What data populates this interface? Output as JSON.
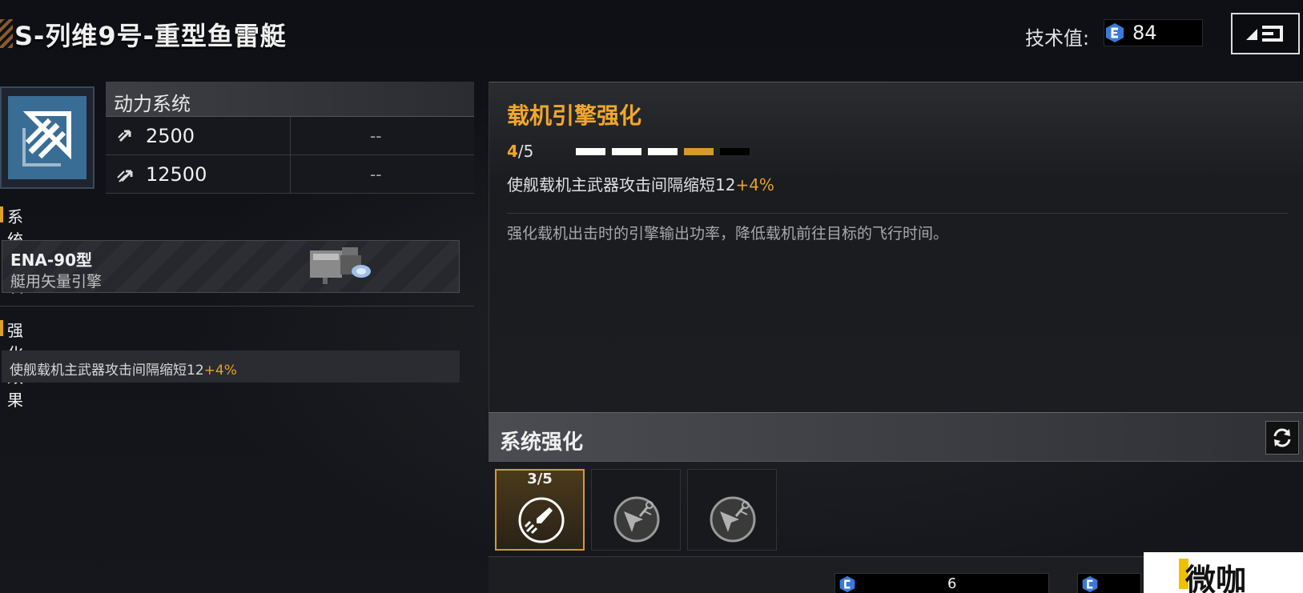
{
  "header": {
    "title": "S-列维9号-重型鱼雷艇",
    "tech_label": "技术值:",
    "tech_value": "84"
  },
  "power_system": {
    "title": "动力系统",
    "stats": [
      {
        "icon": "speed-icon",
        "value": "2500",
        "alt": "--"
      },
      {
        "icon": "boost-speed-icon",
        "value": "12500",
        "alt": "--"
      }
    ]
  },
  "system_module": {
    "section_label": "系统模块",
    "name": "ENA-90型",
    "desc": "艇用矢量引擎"
  },
  "enhance_effect": {
    "section_label": "强化效果",
    "text": "使舰载机主武器攻击间隔缩短12",
    "bonus": "+4%"
  },
  "upgrade": {
    "title": "载机引擎强化",
    "level_current": "4",
    "level_total": "/5",
    "pips": [
      1,
      1,
      1,
      2,
      0
    ],
    "effect_text": "使舰载机主武器攻击间隔缩短12",
    "effect_bonus": "+4%",
    "flavor": "强化载机出击时的引擎输出功率，降低载机前往目标的飞行时间。"
  },
  "system_enhance": {
    "title": "系统强化",
    "slots": [
      {
        "level": "3/5",
        "active": true,
        "icon": "jet-boost-icon"
      },
      {
        "level": "",
        "active": false,
        "icon": "wrench-plane-icon"
      },
      {
        "level": "",
        "active": false,
        "icon": "wrench-plane-icon"
      }
    ]
  },
  "cost": {
    "value": "6"
  },
  "watermark": {
    "text": "微咖"
  },
  "colors": {
    "accent": "#f2a72a",
    "pip_filled": "#ffffff",
    "pip_current": "#d89a2a",
    "pip_empty": "#000000",
    "module_blue": "#3a6d96"
  }
}
